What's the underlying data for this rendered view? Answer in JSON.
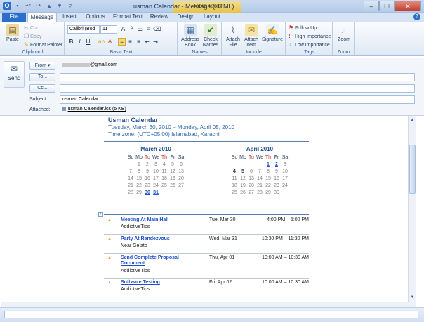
{
  "window": {
    "title": "usman Calendar - Message (HTML)",
    "contextual_tab": "Table Tools",
    "controls": [
      "–",
      "☐",
      "✕"
    ]
  },
  "tabs": [
    "File",
    "Message",
    "Insert",
    "Options",
    "Format Text",
    "Review",
    "Design",
    "Layout"
  ],
  "ribbon": {
    "clipboard": {
      "label": "Clipboard",
      "paste": "Paste",
      "cut": "Cut",
      "copy": "Copy",
      "format_painter": "Format Painter"
    },
    "basic_text": {
      "label": "Basic Text",
      "font": "Calibri (Bod",
      "size": "11"
    },
    "names": {
      "label": "Names",
      "address_book": "Address Book",
      "check_names": "Check Names"
    },
    "include": {
      "label": "Include",
      "attach_file": "Attach File",
      "attach_item": "Attach Item",
      "signature": "Signature"
    },
    "tags": {
      "label": "Tags",
      "follow_up": "Follow Up",
      "high": "High Importance",
      "low": "Low Importance"
    },
    "zoom": {
      "label": "Zoom",
      "zoom": "Zoom"
    }
  },
  "form": {
    "send": "Send",
    "from_label": "From",
    "from_value": "@gmail.com",
    "to_label": "To...",
    "cc_label": "Cc...",
    "subject_label": "Subject:",
    "subject_value": "usman Calendar",
    "attached_label": "Attached:",
    "attachment": "usman Calendar.ics (5 KB)"
  },
  "calendar": {
    "title": "Usman Calendar",
    "range": "Tuesday, March 30, 2010 – Monday, April 05, 2010",
    "timezone": "Time zone: (UTC+05:00) Islamabad, Karachi",
    "day_names": [
      "Su",
      "Mo",
      "Tu",
      "We",
      "Th",
      "Fr",
      "Sa"
    ],
    "march": {
      "title": "March 2010",
      "days": [
        "",
        "1",
        "2",
        "3",
        "4",
        "5",
        "6",
        "7",
        "8",
        "9",
        "10",
        "11",
        "12",
        "13",
        "14",
        "15",
        "16",
        "17",
        "18",
        "19",
        "20",
        "21",
        "22",
        "23",
        "24",
        "25",
        "26",
        "27",
        "28",
        "29",
        "30",
        "31",
        "",
        "",
        ""
      ],
      "highlight": [
        "30",
        "31"
      ]
    },
    "april": {
      "title": "April 2010",
      "days": [
        "",
        "",
        "",
        "",
        "1",
        "2",
        "3",
        "4",
        "5",
        "6",
        "7",
        "8",
        "9",
        "10",
        "11",
        "12",
        "13",
        "14",
        "15",
        "16",
        "17",
        "18",
        "19",
        "20",
        "21",
        "22",
        "23",
        "24",
        "25",
        "26",
        "27",
        "28",
        "29",
        "30",
        ""
      ],
      "highlight": [
        "1",
        "2"
      ],
      "bold": [
        "4",
        "5"
      ]
    },
    "events": [
      {
        "title": "Meeting At Main Hall",
        "location": "AddictiveTips",
        "date": "Tue, Mar 30",
        "time": "4:00 PM – 5:00 PM"
      },
      {
        "title": "Party At Rendezvous",
        "location": "Near Gelato",
        "date": "Wed, Mar 31",
        "time": "10:30 PM – 11:30 PM"
      },
      {
        "title": "Send Complete Proposal Document",
        "location": "AddictiveTips",
        "date": "Thu, Apr 01",
        "time": "10:00 AM – 10:30 AM"
      },
      {
        "title": "Software Testing",
        "location": "AddictiveTips",
        "date": "Fri, Apr 02",
        "time": "10:00 AM – 10:30 AM"
      }
    ]
  }
}
